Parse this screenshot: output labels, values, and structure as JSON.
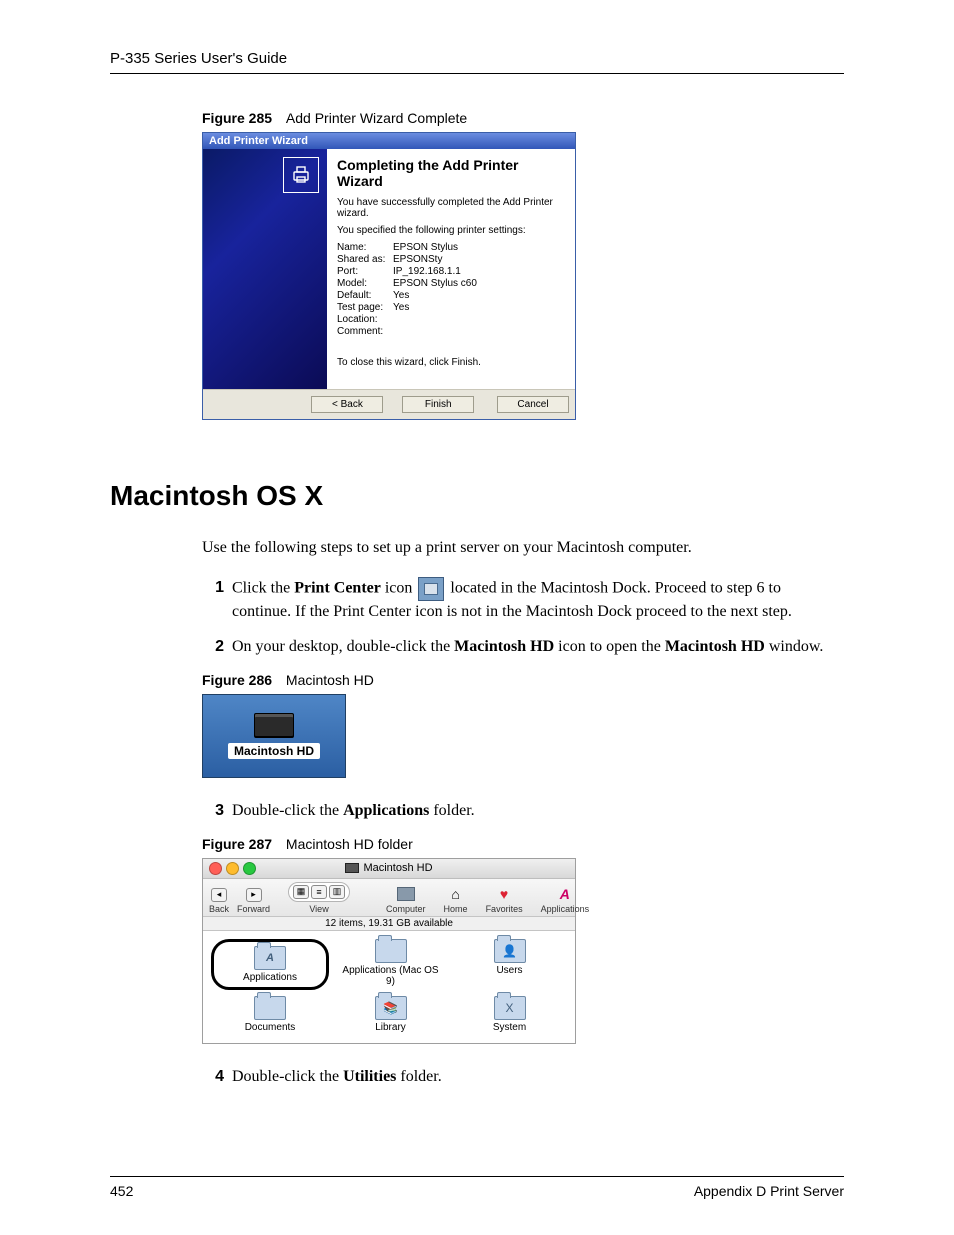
{
  "header": {
    "running": "P-335 Series User's Guide"
  },
  "fig285": {
    "caption_bold": "Figure 285",
    "caption_text": "Add Printer Wizard Complete",
    "title": "Add Printer Wizard",
    "heading": "Completing the Add Printer Wizard",
    "line1": "You have successfully completed the Add Printer wizard.",
    "line2": "You specified the following printer settings:",
    "rows": {
      "name_k": "Name:",
      "name_v": "EPSON Stylus",
      "shared_k": "Shared as:",
      "shared_v": "EPSONSty",
      "port_k": "Port:",
      "port_v": "IP_192.168.1.1",
      "model_k": "Model:",
      "model_v": "EPSON Stylus c60",
      "default_k": "Default:",
      "default_v": "Yes",
      "test_k": "Test page:",
      "test_v": "Yes",
      "loc_k": "Location:",
      "loc_v": "",
      "comm_k": "Comment:",
      "comm_v": ""
    },
    "close_hint": "To close this wizard, click Finish.",
    "btn_back": "< Back",
    "btn_finish": "Finish",
    "btn_cancel": "Cancel"
  },
  "section": {
    "heading": "Macintosh OS X"
  },
  "intro": "Use the following steps to set up a print server on your Macintosh computer.",
  "steps": {
    "n1": "1",
    "s1a": "Click the ",
    "s1b": "Print Center",
    "s1c": " icon ",
    "s1d": " located in the Macintosh Dock. Proceed to step 6 to continue.  If the Print Center icon is not in the Macintosh Dock proceed to the next step.",
    "n2": "2",
    "s2a": "On your desktop, double-click the ",
    "s2b": "Macintosh HD",
    "s2c": " icon to open the ",
    "s2d": "Macintosh HD",
    "s2e": " window.",
    "n3": "3",
    "s3a": "Double-click the ",
    "s3b": "Applications",
    "s3c": " folder.",
    "n4": "4",
    "s4a": "Double-click the ",
    "s4b": "Utilities",
    "s4c": " folder."
  },
  "fig286": {
    "caption_bold": "Figure 286",
    "caption_text": "Macintosh HD",
    "label": "Macintosh HD"
  },
  "fig287": {
    "caption_bold": "Figure 287",
    "caption_text": "Macintosh HD folder",
    "window_title": "Macintosh HD",
    "toolbar": {
      "back": "Back",
      "forward": "Forward",
      "view": "View",
      "computer": "Computer",
      "home": "Home",
      "favorites": "Favorites",
      "applications": "Applications"
    },
    "status": "12 items, 19.31 GB available",
    "items": {
      "applications": "Applications",
      "applications9": "Applications (Mac OS 9)",
      "users": "Users",
      "documents": "Documents",
      "library": "Library",
      "system": "System"
    }
  },
  "footer": {
    "page": "452",
    "right": "Appendix D Print Server"
  }
}
